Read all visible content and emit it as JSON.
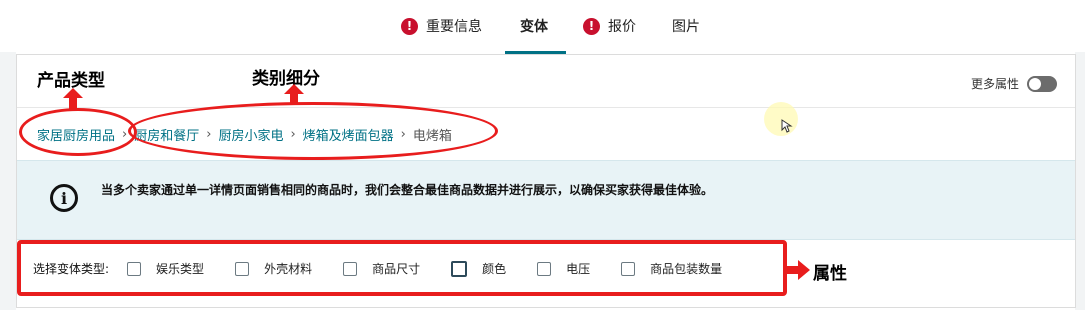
{
  "tabs": [
    {
      "label": "重要信息",
      "warning": true,
      "active": false
    },
    {
      "label": "变体",
      "warning": false,
      "active": true
    },
    {
      "label": "报价",
      "warning": true,
      "active": false
    },
    {
      "label": "图片",
      "warning": false,
      "active": false
    }
  ],
  "warning_glyph": "!",
  "header": {
    "more_attributes_label": "更多属性",
    "toggle_on": false
  },
  "breadcrumb": [
    "家居厨房用品",
    "厨房和餐厅",
    "厨房小家电",
    "烤箱及烤面包器",
    "电烤箱"
  ],
  "breadcrumb_separator": "›",
  "info": {
    "icon": "info-icon",
    "icon_glyph": "i",
    "text": "当多个卖家通过单一详情页面销售相同的商品时，我们会整合最佳商品数据并进行展示，以确保买家获得最佳体验。"
  },
  "variation": {
    "label": "选择变体类型:",
    "options": [
      {
        "label": "娱乐类型",
        "checked": false
      },
      {
        "label": "外壳材料",
        "checked": false
      },
      {
        "label": "商品尺寸",
        "checked": false
      },
      {
        "label": "颜色",
        "checked": false
      },
      {
        "label": "电压",
        "checked": false
      },
      {
        "label": "商品包装数量",
        "checked": false
      }
    ]
  },
  "annotations": {
    "product_type": "产品类型",
    "category_breakdown": "类别细分",
    "attributes": "属性"
  },
  "colors": {
    "accent": "#007185",
    "warning": "#c8102e",
    "annotation_red": "#e81d1d",
    "info_bg": "#e8f3f6"
  }
}
